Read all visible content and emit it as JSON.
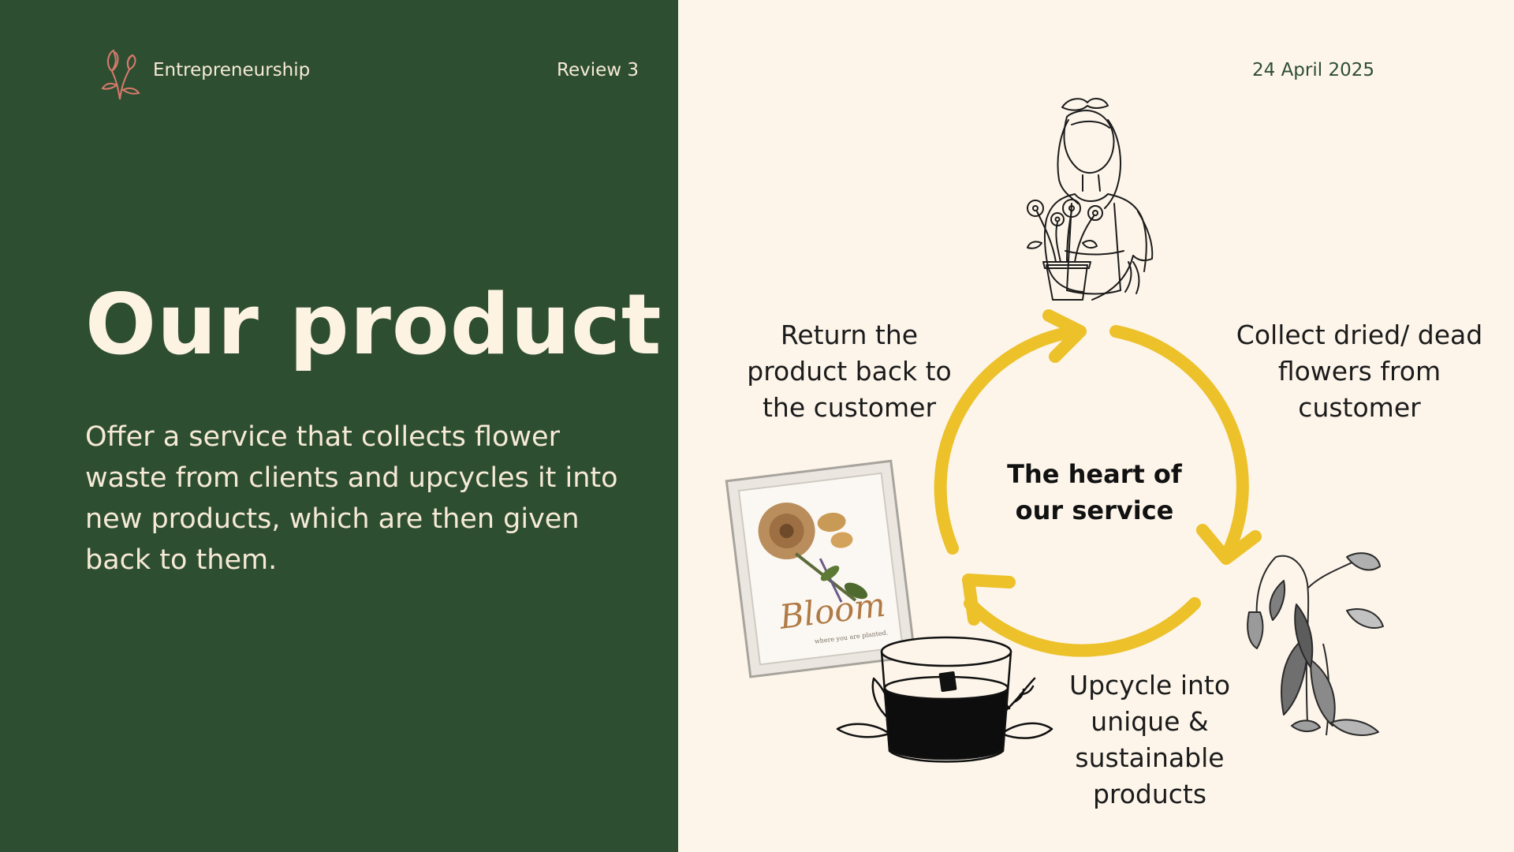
{
  "header": {
    "brand": "Entrepreneurship",
    "review": "Review 3",
    "date": "24 April  2025"
  },
  "main": {
    "title": "Our product",
    "description": "Offer a service that collects flower waste from clients and upcycles it into new products, which are then given back to them."
  },
  "cycle": {
    "center_label": "The heart of our service",
    "steps": [
      "Return the product back to the customer",
      "Collect dried/ dead flowers from customer",
      "Upcycle into unique & sustainable products"
    ],
    "arrow_color": "#ecc12a"
  },
  "frame": {
    "script_text": "Bloom",
    "caption": "where you are planted."
  },
  "colors": {
    "green": "#2e4e32",
    "cream": "#fdf5ea"
  }
}
